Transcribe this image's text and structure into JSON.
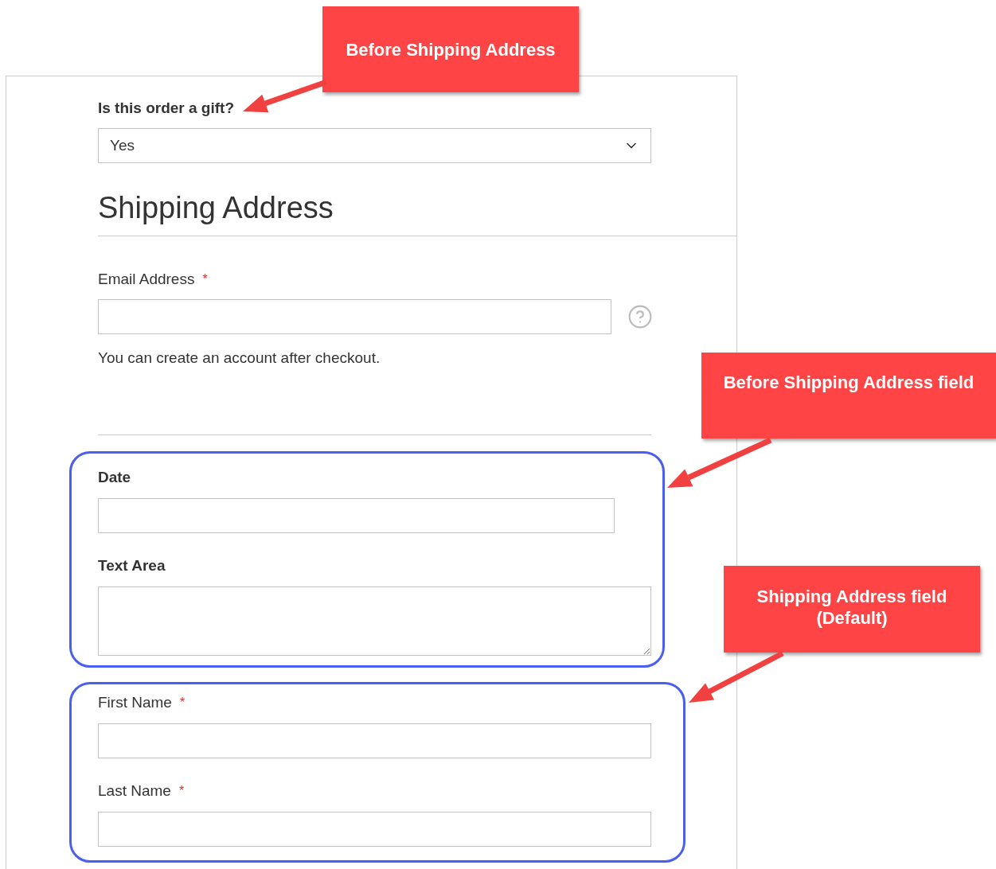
{
  "gift_question": {
    "label": "Is this order a gift?",
    "select": {
      "value": "Yes"
    }
  },
  "heading": "Shipping Address",
  "email": {
    "label": "Email Address",
    "required_mark": "*",
    "hint": "You can create an account after checkout."
  },
  "custom_fields": [
    {
      "kind": "input",
      "label": "Date"
    },
    {
      "kind": "textarea",
      "label": "Text Area"
    }
  ],
  "name_fields": [
    {
      "label": "First Name",
      "required_mark": "*"
    },
    {
      "label": "Last Name",
      "required_mark": "*"
    }
  ],
  "callouts": [
    {
      "text": "Before Shipping Address"
    },
    {
      "text": "Before Shipping Address field"
    },
    {
      "text": "Shipping Address field (Default)"
    }
  ]
}
